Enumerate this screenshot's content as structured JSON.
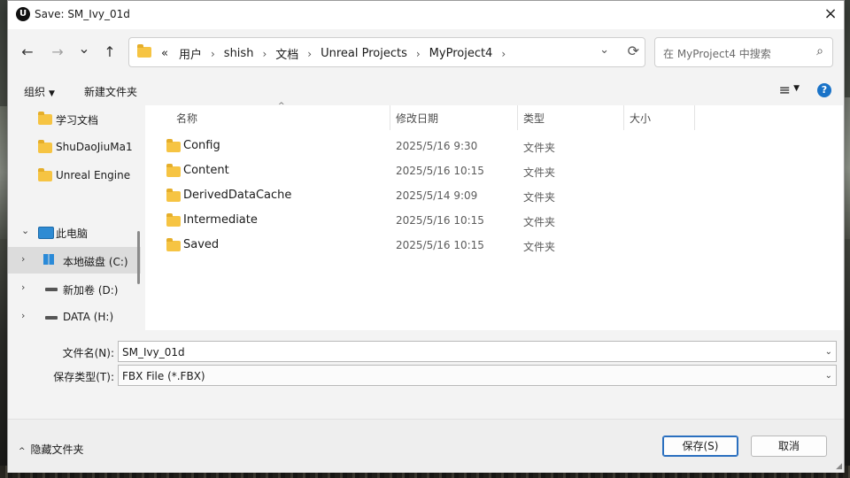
{
  "window": {
    "title": "Save: SM_Ivy_01d",
    "app_icon_text": "U",
    "close_icon": "×"
  },
  "nav": {
    "back_icon": "←",
    "forward_icon": "→",
    "recent_icon": "⌄",
    "up_icon": "↑",
    "breadcrumb_overflow": "«",
    "breadcrumbs": [
      "用户",
      "shish",
      "文档",
      "Unreal Projects",
      "MyProject4"
    ],
    "crumb_separator": "›",
    "address_dropdown_icon": "⌄",
    "refresh_icon": "⟳",
    "search_placeholder": "在 MyProject4 中搜索",
    "search_icon": "⌕"
  },
  "toolbar": {
    "organize_label": "组织",
    "new_folder_label": "新建文件夹",
    "view_icon": "≡",
    "dropdown_caret": "▼",
    "help_icon": "?"
  },
  "sidebar": {
    "quick_items": [
      {
        "label": "学习文档"
      },
      {
        "label": "ShuDaoJiuMa1"
      },
      {
        "label": "Unreal Engine"
      }
    ],
    "this_pc": {
      "label": "此电脑",
      "chevron": "⌄"
    },
    "drives": [
      {
        "label": "本地磁盘 (C:)",
        "chevron": "›"
      },
      {
        "label": "新加卷 (D:)",
        "chevron": "›"
      },
      {
        "label": "DATA (H:)",
        "chevron": "›"
      }
    ]
  },
  "columns": {
    "name": "名称",
    "date": "修改日期",
    "type": "类型",
    "size": "大小",
    "sort_arrow": "^"
  },
  "files": [
    {
      "name": "Config",
      "date": "2025/5/16 9:30",
      "type": "文件夹"
    },
    {
      "name": "Content",
      "date": "2025/5/16 10:15",
      "type": "文件夹"
    },
    {
      "name": "DerivedDataCache",
      "date": "2025/5/14 9:09",
      "type": "文件夹"
    },
    {
      "name": "Intermediate",
      "date": "2025/5/16 10:15",
      "type": "文件夹"
    },
    {
      "name": "Saved",
      "date": "2025/5/16 10:15",
      "type": "文件夹"
    }
  ],
  "form": {
    "filename_label": "文件名(N):",
    "filename_value": "SM_Ivy_01d",
    "filetype_label": "保存类型(T):",
    "filetype_value": "FBX File (*.FBX)",
    "dropdown_icon": "⌄"
  },
  "footer": {
    "hide_folders_label": "隐藏文件夹",
    "hide_icon": "^",
    "save_label": "保存(S)",
    "cancel_label": "取消"
  }
}
